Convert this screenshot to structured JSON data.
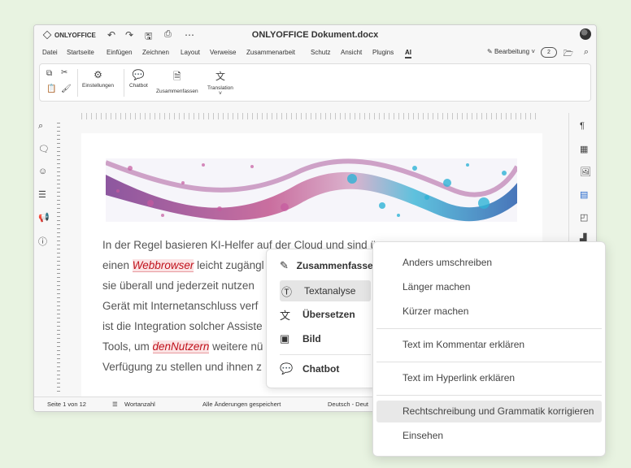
{
  "app": {
    "logo_text": "ONLYOFFICE",
    "doc_title": "ONLYOFFICE Dokument.docx",
    "edit_mode": "Bearbeitung",
    "users_count": "2"
  },
  "menubar": [
    "Datei",
    "Startseite",
    "Einfügen",
    "Zeichnen",
    "Layout",
    "Verweise",
    "Zusammenarbeit",
    "Schutz",
    "Ansicht",
    "Plugins",
    "AI"
  ],
  "ribbon": {
    "settings": "Einstellungen",
    "chatbot": "Chatbot",
    "summarize": "Zusammenfassen",
    "translation": "Translation"
  },
  "document": {
    "lines": [
      {
        "pre": "In der Regel basieren KI-Helfer auf der Cloud und sind ü",
        "err": "",
        "post": ""
      },
      {
        "pre": "einen ",
        "err": "Webbrowser",
        "post": " leicht zugängl"
      },
      {
        "pre": "sie überall und jederzeit nutzen ",
        "err": "",
        "post": ""
      },
      {
        "pre": "Gerät mit Internetanschluss verf",
        "err": "",
        "post": ""
      },
      {
        "pre": "ist die Integration solcher Assiste",
        "err": "",
        "post": ""
      },
      {
        "pre": "Tools, um ",
        "err": "denNutzern",
        "post": " weitere nü"
      },
      {
        "pre": "Verfügung zu stellen und ihnen z",
        "err": "",
        "post": ""
      }
    ]
  },
  "status": {
    "page": "Seite 1 von 12",
    "wordcount": "Wortanzahl",
    "saved": "Alle Änderungen gespeichert",
    "language": "Deutsch - Deut"
  },
  "context_menu": {
    "items": [
      {
        "label": "Zusammenfassen",
        "icon": "summarize-icon",
        "glyph": "✎"
      },
      {
        "label": "Textanalyse",
        "icon": "text-analysis-icon",
        "glyph": "Ⓣ"
      },
      {
        "label": "Übersetzen",
        "icon": "translate-icon",
        "glyph": "文"
      },
      {
        "label": "Bild",
        "icon": "image-icon",
        "glyph": "▣"
      },
      {
        "label": "Chatbot",
        "icon": "chatbot-icon",
        "glyph": "💬"
      }
    ]
  },
  "submenu": {
    "items": [
      "Anders umschreiben",
      "Länger machen",
      "Kürzer machen",
      "Text im Kommentar erklären",
      "Text im Hyperlink erklären",
      "Rechtschreibung und Grammatik korrigieren",
      "Einsehen"
    ]
  }
}
